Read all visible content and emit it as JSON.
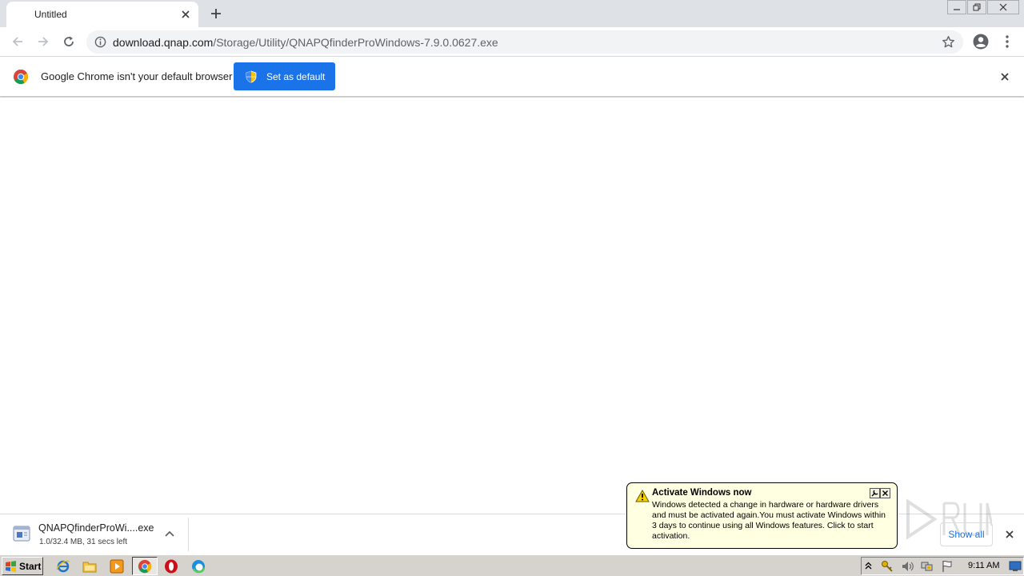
{
  "browser": {
    "tab": {
      "title": "Untitled"
    },
    "address": {
      "host": "download.qnap.com",
      "path": "/Storage/Utility/QNAPQfinderProWindows-7.9.0.0627.exe"
    }
  },
  "infobar": {
    "message": "Google Chrome isn't your default browser",
    "button_label": "Set as default"
  },
  "downloads": {
    "items": [
      {
        "name": "QNAPQfinderProWi....exe",
        "status": "1.0/32.4 MB, 31 secs left"
      }
    ],
    "show_all_label": "Show all"
  },
  "notification": {
    "title": "Activate Windows now",
    "body": "Windows detected a change in hardware or hardware drivers and must be activated again.You must activate Windows within 3 days to continue using all Windows features. Click to start activation."
  },
  "taskbar": {
    "start_label": "Start",
    "clock": "9:11 AM"
  },
  "colors": {
    "accent": "#1a73e8",
    "tabstrip": "#dee1e6",
    "balloon": "#ffffe1",
    "taskbar": "#d6d3ce"
  }
}
